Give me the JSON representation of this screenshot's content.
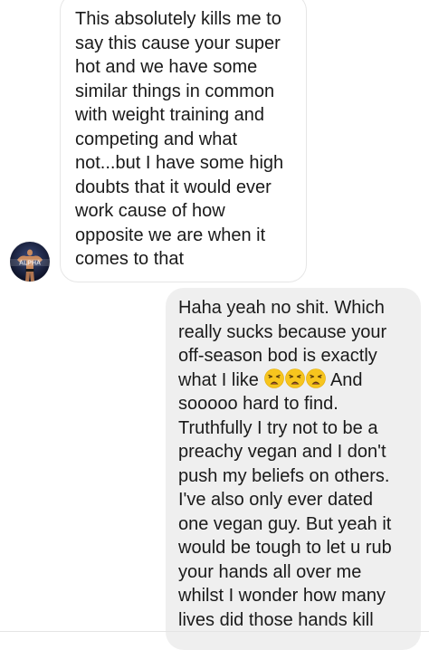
{
  "conversation": {
    "incoming_message": {
      "lines": [
        "This absolutely kills me to",
        "say this cause your super",
        "hot and we have some",
        "similar things in common",
        "with weight training and",
        "competing and what",
        "not...but I have some high",
        "doubts that it would ever",
        "work cause of how",
        "opposite we are when it",
        "comes to that"
      ],
      "avatar_icon": "bodybuilder-avatar",
      "avatar_overlay_text": "ALPHA"
    },
    "outgoing_message": {
      "lines": [
        "Haha yeah no shit. Which",
        "really sucks because your",
        "off-season bod is exactly",
        "what I like",
        "And",
        "sooooo hard to find.",
        "Truthfully I try not to be a",
        "preachy vegan and I don't",
        "push my beliefs on others.",
        "I've also only ever dated",
        "one vegan guy. But yeah it",
        "would be tough to let u rub",
        "your hands all over me",
        "whilst I wonder how many",
        "lives did those hands kill"
      ],
      "emoji_icons": [
        "weary-face-emoji",
        "weary-face-emoji",
        "weary-face-emoji"
      ]
    }
  }
}
